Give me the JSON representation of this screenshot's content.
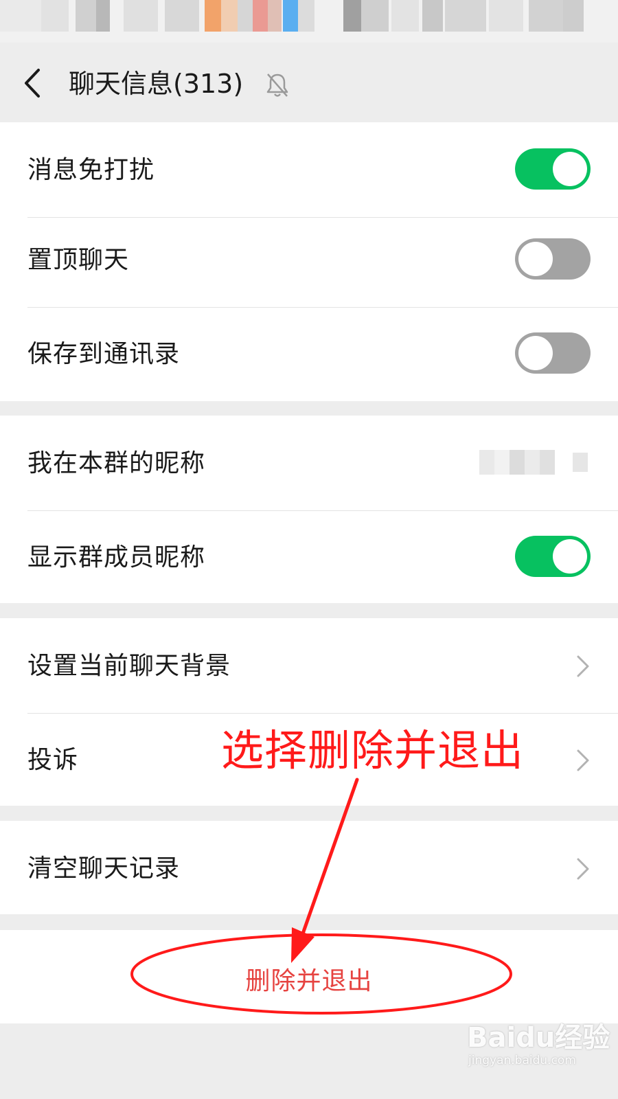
{
  "header": {
    "title": "聊天信息(313)"
  },
  "group1": {
    "rows": [
      {
        "label": "消息免打扰",
        "toggle": "on"
      },
      {
        "label": "置顶聊天",
        "toggle": "off"
      },
      {
        "label": "保存到通讯录",
        "toggle": "off"
      }
    ]
  },
  "group2": {
    "rows": [
      {
        "label": "我在本群的昵称",
        "value": "(blurred)"
      },
      {
        "label": "显示群成员昵称",
        "toggle": "on"
      }
    ]
  },
  "group3": {
    "rows": [
      {
        "label": "设置当前聊天背景"
      },
      {
        "label": "投诉"
      }
    ]
  },
  "group4": {
    "rows": [
      {
        "label": "清空聊天记录"
      }
    ]
  },
  "delete_button": "删除并退出",
  "annotation": "选择删除并退出",
  "watermark": {
    "brand": "Baidu经验",
    "url": "jingyan.baidu.com"
  },
  "colors": {
    "toggle_on": "#07c160",
    "toggle_off": "#a3a3a3",
    "danger": "#e64340",
    "annotation": "#ff1a1a"
  }
}
